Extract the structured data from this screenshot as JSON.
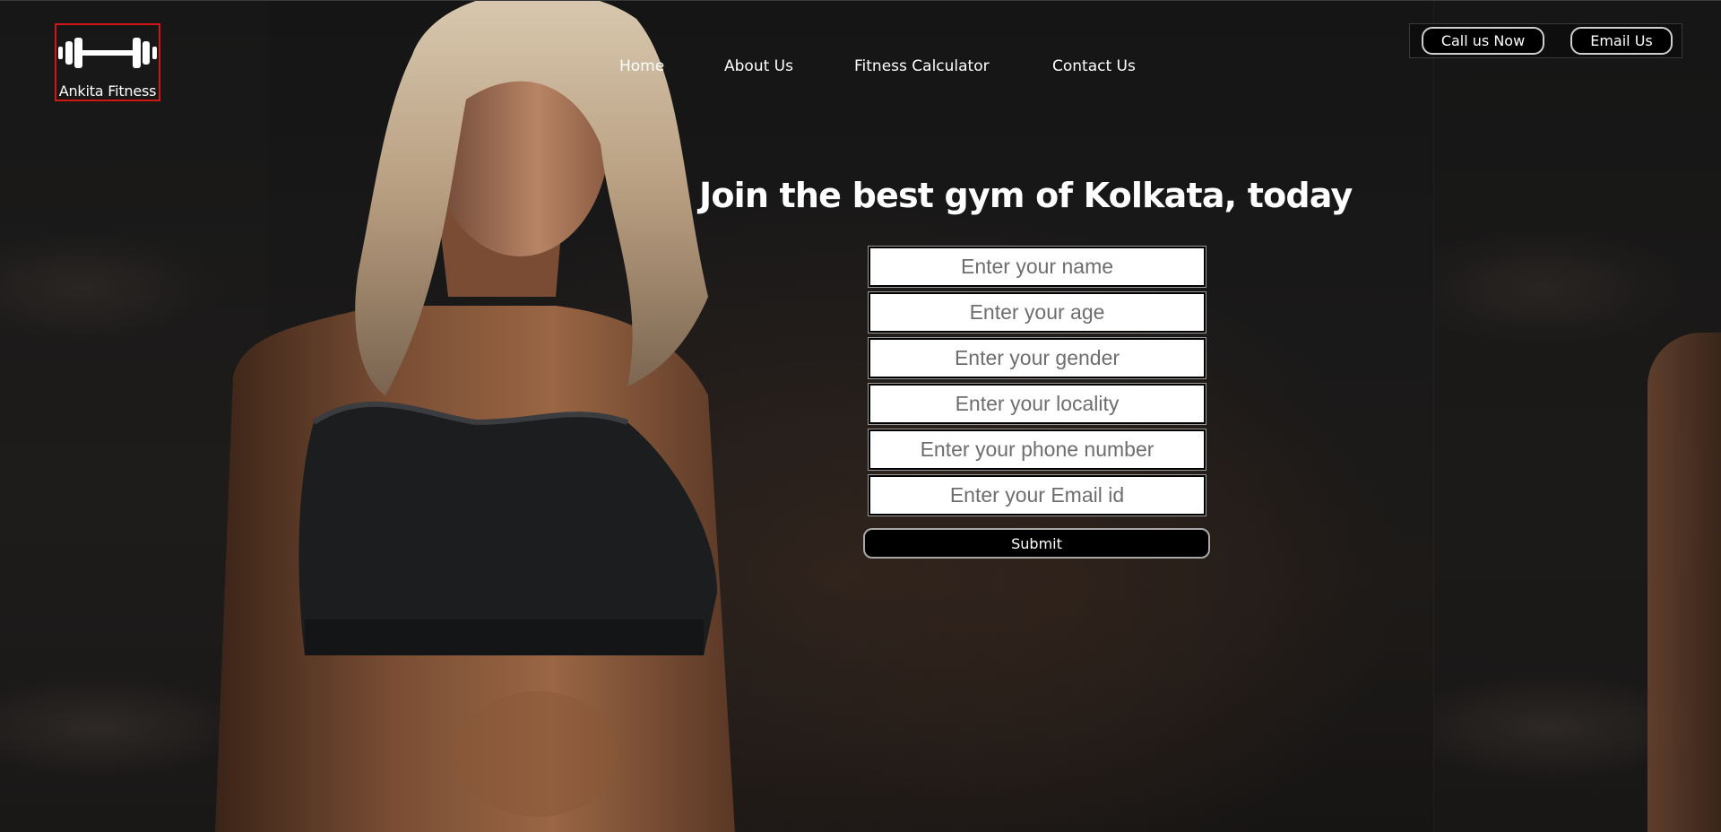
{
  "brand": {
    "name": "Ankita Fitness",
    "logo_icon": "dumbbell-icon",
    "logo_border_color": "#d41515"
  },
  "nav": {
    "items": [
      {
        "label": "Home"
      },
      {
        "label": "About Us"
      },
      {
        "label": "Fitness Calculator"
      },
      {
        "label": "Contact Us"
      }
    ]
  },
  "contact": {
    "call_label": "Call us Now",
    "email_label": "Email Us"
  },
  "hero": {
    "headline": "Join the best gym of Kolkata, today",
    "fields": [
      {
        "placeholder": "Enter your name"
      },
      {
        "placeholder": "Enter your age"
      },
      {
        "placeholder": "Enter your gender"
      },
      {
        "placeholder": "Enter your locality"
      },
      {
        "placeholder": "Enter your phone number"
      },
      {
        "placeholder": "Enter your Email id"
      }
    ],
    "submit_label": "Submit"
  }
}
